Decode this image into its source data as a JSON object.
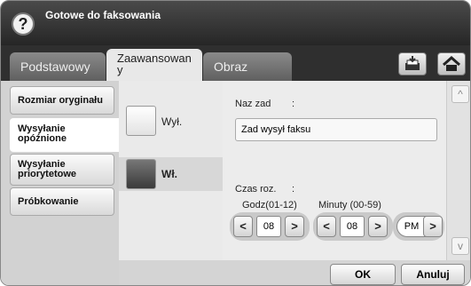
{
  "header": {
    "help_icon": "?",
    "status": "Gotowe do faksowania"
  },
  "tabs": [
    {
      "label": "Podstawowy"
    },
    {
      "label": "Zaawansowany"
    },
    {
      "label": "Obraz"
    }
  ],
  "icons": {
    "tray": "tray-icon",
    "home": "home-icon"
  },
  "sidebar": {
    "items": [
      {
        "label": "Rozmiar oryginału"
      },
      {
        "label": "Wysyłanie opóźnione"
      },
      {
        "label": "Wysyłanie priorytetowe"
      },
      {
        "label": "Próbkowanie"
      }
    ]
  },
  "options": {
    "off": "Wył.",
    "on": "Wł."
  },
  "form": {
    "job_name_label": "Naz zad",
    "colon": ":",
    "job_name_value": "Zad wysył faksu",
    "time_label": "Czas roz.",
    "hour_label": "Godz(01-12)",
    "minute_label": "Minuty (00-59)",
    "hour_value": "08",
    "minute_value": "08",
    "ampm_value": "PM",
    "left_arrow": "<",
    "right_arrow": ">"
  },
  "scroll": {
    "up": "^",
    "down": "v"
  },
  "footer": {
    "ok": "OK",
    "cancel": "Anuluj"
  }
}
